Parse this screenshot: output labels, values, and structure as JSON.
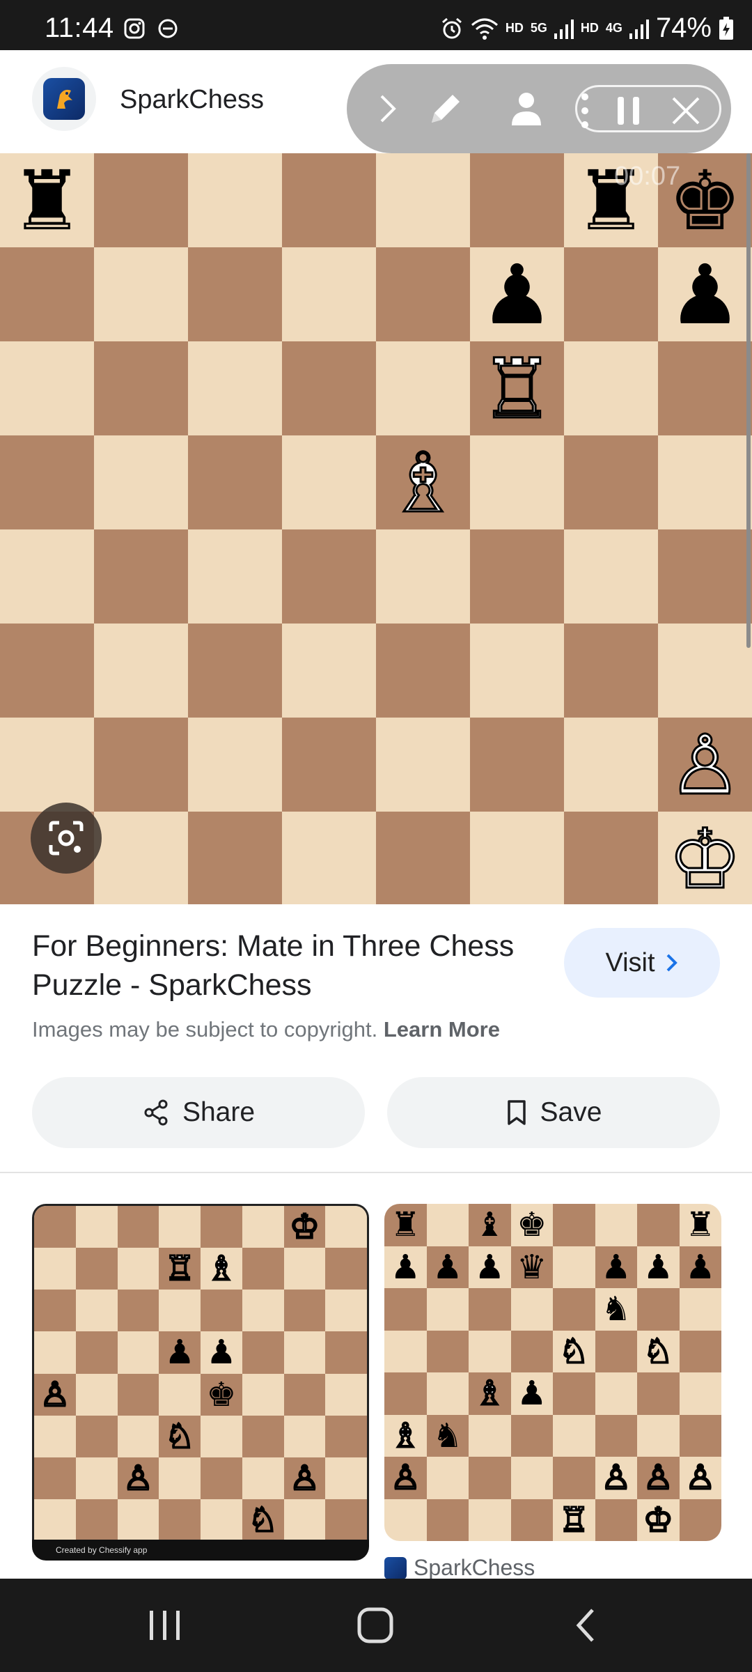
{
  "status_bar": {
    "time": "11:44",
    "left_icons": [
      "instagram-icon",
      "do-not-disturb-icon"
    ],
    "right_icons": [
      "alarm-icon",
      "wifi-icon",
      "hd-icon",
      "5g-signal-icon",
      "hd-icon",
      "4g-signal-icon",
      "battery-charging-icon"
    ],
    "hd1": "HD",
    "net1": "5G",
    "hd2": "HD",
    "net2": "4G",
    "battery": "74%"
  },
  "header": {
    "site_name": "SparkChess",
    "logo_icon": "sparkchess-logo-icon"
  },
  "toolbar": {
    "icons": [
      "chevron-right-icon",
      "pen-icon",
      "person-icon",
      "more-vertical-icon",
      "pause-icon",
      "close-icon"
    ],
    "timer": "00:07"
  },
  "board": {
    "ranks": [
      [
        {
          "p": "♜",
          "c": "b"
        },
        null,
        null,
        null,
        null,
        null,
        {
          "p": "♜",
          "c": "b"
        },
        {
          "p": "♚",
          "c": "b"
        }
      ],
      [
        null,
        null,
        null,
        null,
        null,
        {
          "p": "♟",
          "c": "b"
        },
        null,
        {
          "p": "♟",
          "c": "b"
        }
      ],
      [
        null,
        null,
        null,
        null,
        null,
        {
          "p": "♖",
          "c": "w"
        },
        null,
        null
      ],
      [
        null,
        null,
        null,
        null,
        {
          "p": "♗",
          "c": "w"
        },
        null,
        null,
        null
      ],
      [
        null,
        null,
        null,
        null,
        null,
        null,
        null,
        null
      ],
      [
        null,
        null,
        null,
        null,
        null,
        null,
        null,
        null
      ],
      [
        null,
        null,
        null,
        null,
        null,
        null,
        null,
        {
          "p": "♙",
          "c": "w"
        }
      ],
      [
        null,
        null,
        null,
        null,
        null,
        null,
        null,
        {
          "p": "♔",
          "c": "w"
        }
      ]
    ],
    "colors": {
      "light": "#f0dbbd",
      "dark": "#b28567"
    }
  },
  "result": {
    "title": "For Beginners: Mate in Three Chess Puzzle - SparkChess",
    "visit_label": "Visit",
    "copyright_text": "Images may be subject to copyright.",
    "learn_more": "Learn More",
    "share_label": "Share",
    "save_label": "Save"
  },
  "related": [
    {
      "footer": "Created by Chessify app",
      "ranks": [
        [
          null,
          null,
          null,
          null,
          null,
          null,
          {
            "p": "♔",
            "c": "w"
          },
          null
        ],
        [
          null,
          null,
          null,
          {
            "p": "♖",
            "c": "w"
          },
          {
            "p": "♗",
            "c": "w"
          },
          null,
          null,
          null
        ],
        [
          null,
          null,
          null,
          null,
          null,
          null,
          null,
          null
        ],
        [
          null,
          null,
          null,
          {
            "p": "♟",
            "c": "b"
          },
          {
            "p": "♟",
            "c": "b"
          },
          null,
          null,
          null
        ],
        [
          {
            "p": "♙",
            "c": "w"
          },
          null,
          null,
          null,
          {
            "p": "♚",
            "c": "b"
          },
          null,
          null,
          null
        ],
        [
          null,
          null,
          null,
          {
            "p": "♘",
            "c": "w"
          },
          null,
          null,
          null,
          null
        ],
        [
          null,
          null,
          {
            "p": "♙",
            "c": "w"
          },
          null,
          null,
          null,
          {
            "p": "♙",
            "c": "w"
          },
          null
        ],
        [
          null,
          null,
          null,
          null,
          null,
          {
            "p": "♘",
            "c": "w"
          },
          null,
          null
        ]
      ]
    },
    {
      "source": "SparkChess",
      "ranks": [
        [
          {
            "p": "♜",
            "c": "b"
          },
          null,
          {
            "p": "♝",
            "c": "b"
          },
          {
            "p": "♚",
            "c": "b"
          },
          null,
          null,
          null,
          {
            "p": "♜",
            "c": "b"
          }
        ],
        [
          {
            "p": "♟",
            "c": "b"
          },
          {
            "p": "♟",
            "c": "b"
          },
          {
            "p": "♟",
            "c": "b"
          },
          {
            "p": "♛",
            "c": "b"
          },
          null,
          {
            "p": "♟",
            "c": "b"
          },
          {
            "p": "♟",
            "c": "b"
          },
          {
            "p": "♟",
            "c": "b"
          }
        ],
        [
          null,
          null,
          null,
          null,
          null,
          {
            "p": "♞",
            "c": "b"
          },
          null,
          null
        ],
        [
          null,
          null,
          null,
          null,
          {
            "p": "♘",
            "c": "w"
          },
          null,
          {
            "p": "♘",
            "c": "w"
          },
          null
        ],
        [
          null,
          null,
          {
            "p": "♗",
            "c": "w"
          },
          {
            "p": "♟",
            "c": "b"
          },
          null,
          null,
          null,
          null
        ],
        [
          {
            "p": "♗",
            "c": "w"
          },
          {
            "p": "♞",
            "c": "b"
          },
          null,
          null,
          null,
          null,
          null,
          null
        ],
        [
          {
            "p": "♙",
            "c": "w"
          },
          null,
          null,
          null,
          null,
          {
            "p": "♙",
            "c": "w"
          },
          {
            "p": "♙",
            "c": "w"
          },
          {
            "p": "♙",
            "c": "w"
          }
        ],
        [
          null,
          null,
          null,
          null,
          {
            "p": "♖",
            "c": "w"
          },
          null,
          {
            "p": "♔",
            "c": "w"
          },
          null
        ]
      ]
    }
  ],
  "nav": {
    "icons": [
      "recent-apps-icon",
      "home-icon",
      "back-icon"
    ]
  }
}
